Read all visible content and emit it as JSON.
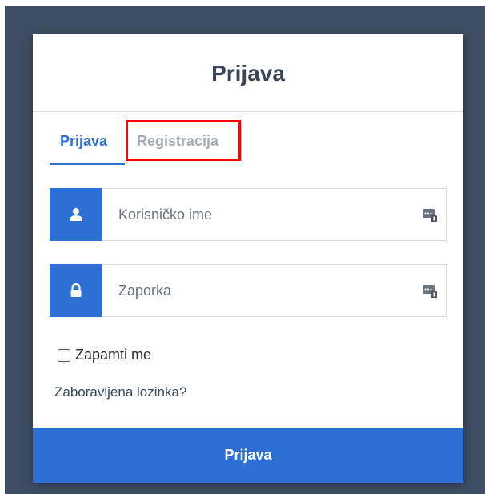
{
  "modal": {
    "title": "Prijava"
  },
  "tabs": [
    {
      "label": "Prijava",
      "active": true
    },
    {
      "label": "Registracija",
      "active": false
    }
  ],
  "fields": {
    "username": {
      "placeholder": "Korisničko ime",
      "value": "",
      "icon": "user-icon",
      "end_icon": "password-manager-icon"
    },
    "password": {
      "placeholder": "Zaporka",
      "value": "",
      "icon": "lock-icon",
      "end_icon": "password-manager-icon"
    }
  },
  "remember": {
    "label": "Zapamti me",
    "checked": false
  },
  "forgot_link": "Zaboravljena lozinka?",
  "submit_label": "Prijava",
  "colors": {
    "backdrop": "#3f4d62",
    "accent": "#2e6fd4",
    "inactive_tab": "#a5acb6",
    "highlight": "#ff0000"
  }
}
